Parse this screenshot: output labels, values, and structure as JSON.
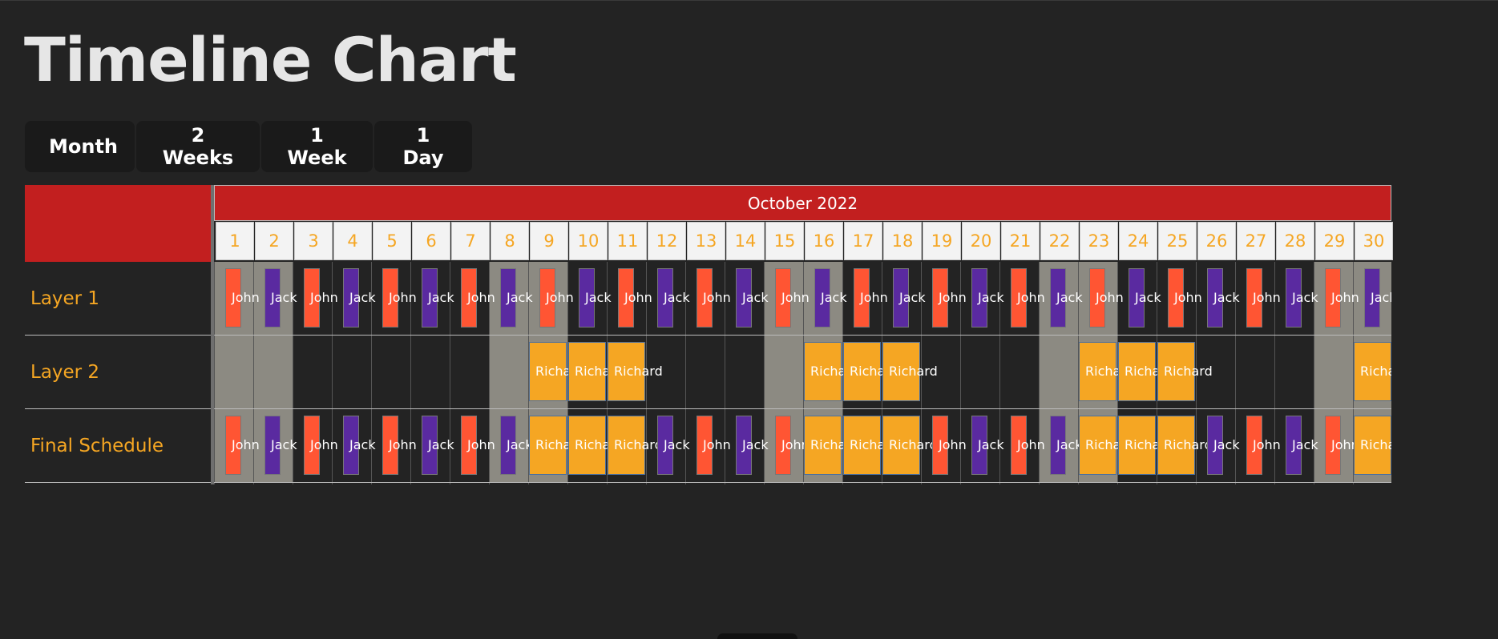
{
  "page": {
    "title": "Timeline Chart"
  },
  "toolbar": {
    "buttons": [
      {
        "id": "month",
        "label": "Month"
      },
      {
        "id": "2weeks",
        "label": "2 Weeks"
      },
      {
        "id": "1week",
        "label": "1 Week"
      },
      {
        "id": "1day",
        "label": "1 Day"
      }
    ]
  },
  "timeline": {
    "month_label": "October 2022",
    "days": [
      "1",
      "2",
      "3",
      "4",
      "5",
      "6",
      "7",
      "8",
      "9",
      "10",
      "11",
      "12",
      "13",
      "14",
      "15",
      "16",
      "17",
      "18",
      "19",
      "20",
      "21",
      "22",
      "23",
      "24",
      "25",
      "26",
      "27",
      "28",
      "29",
      "30"
    ],
    "weekend_days": [
      1,
      2,
      8,
      9,
      15,
      16,
      22,
      23,
      29,
      30
    ],
    "layers": [
      {
        "id": "layer1",
        "label": "Layer 1"
      },
      {
        "id": "layer2",
        "label": "Layer 2"
      },
      {
        "id": "final",
        "label": "Final Schedule"
      }
    ],
    "people": {
      "john": "John",
      "jack": "Jack",
      "richard": "Richard"
    },
    "colors": {
      "header": "#c21f1f",
      "day_text": "#f5a623",
      "john": "#ff5533",
      "jack": "#5a2aa0",
      "richard": "#f5a623",
      "weekend": "#8c8a82",
      "background": "#232323"
    },
    "layer1_assignments": [
      "john",
      "jack",
      "john",
      "jack",
      "john",
      "jack",
      "john",
      "jack",
      "john",
      "jack",
      "john",
      "jack",
      "john",
      "jack",
      "john",
      "jack",
      "john",
      "jack",
      "john",
      "jack",
      "john",
      "jack",
      "john",
      "jack",
      "john",
      "jack",
      "john",
      "jack",
      "john",
      "jack"
    ],
    "layer2_richard_days": [
      9,
      10,
      11,
      16,
      17,
      18,
      23,
      24,
      25,
      30
    ]
  }
}
